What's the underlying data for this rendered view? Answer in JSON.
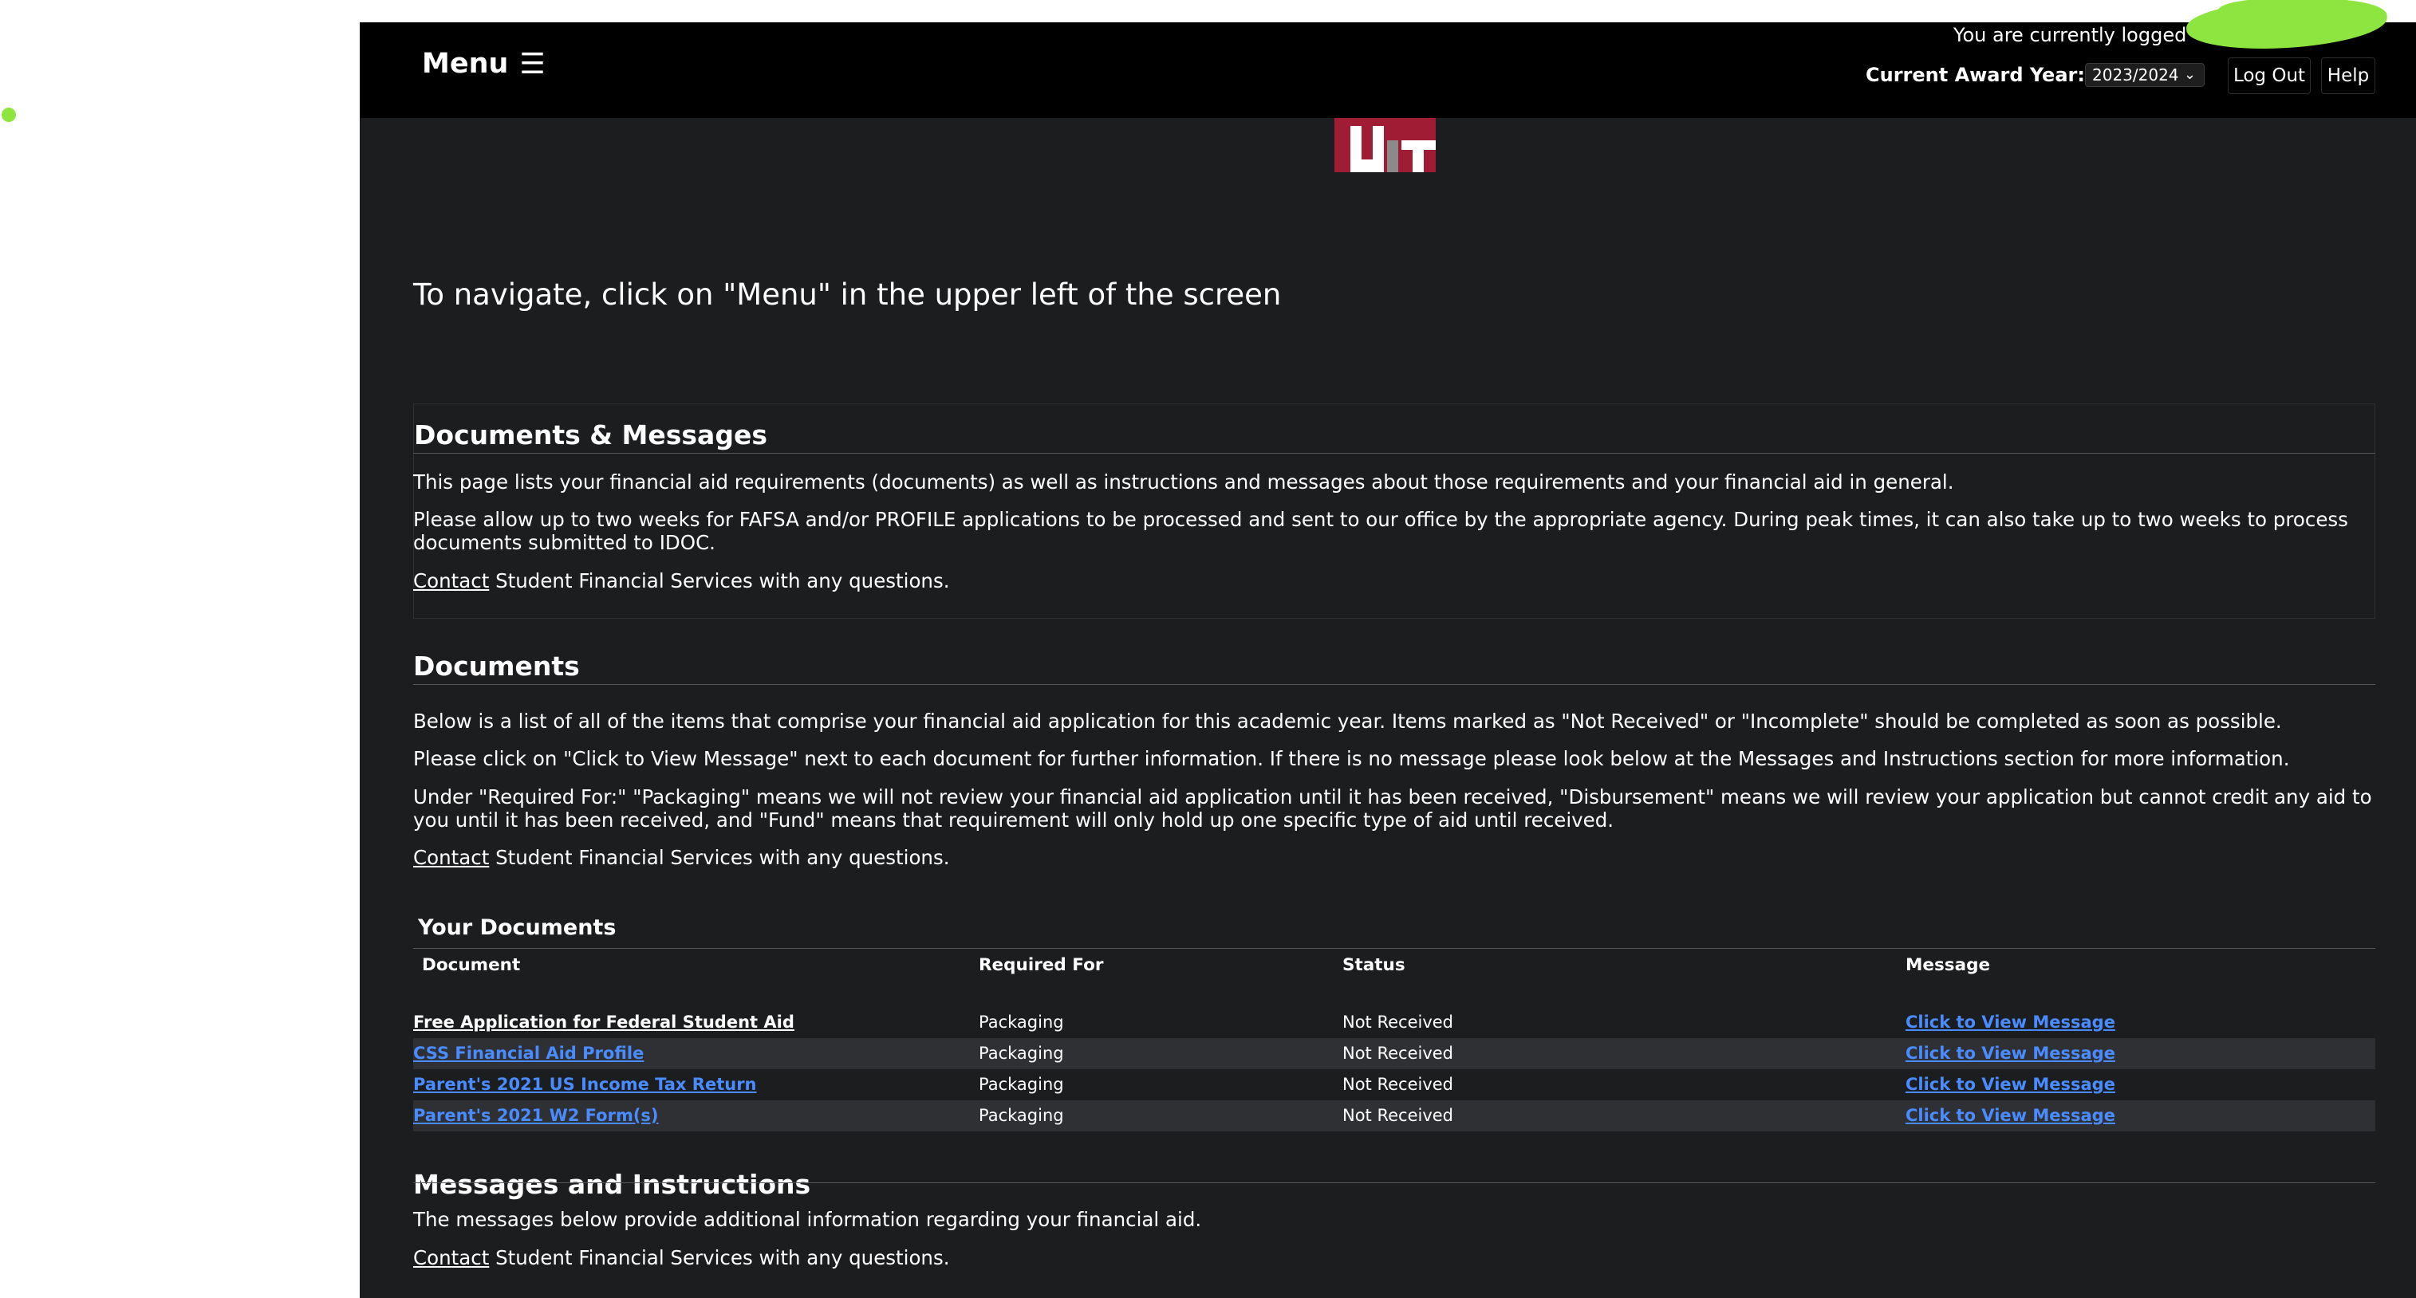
{
  "header": {
    "menu_label": "Menu",
    "menu_icon": "☰",
    "logged_in_text": "You are currently logged",
    "award_year_label": "Current Award Year:",
    "award_year_value": "2023/2024",
    "logout_label": "Log Out",
    "help_label": "Help"
  },
  "nav_hint": "To navigate, click on \"Menu\" in the upper left of the screen",
  "doc_messages": {
    "title": "Documents & Messages",
    "p1": "This page lists your financial aid requirements (documents) as well as instructions and messages about those requirements and your financial aid in general.",
    "p2": "Please allow up to two weeks for FAFSA and/or PROFILE applications to be processed and sent to our office by the appropriate agency. During peak times, it can also take up to two weeks to process documents submitted to IDOC.",
    "contact_link": "Contact",
    "contact_rest": " Student Financial Services with any questions."
  },
  "documents": {
    "title": "Documents",
    "p1": "Below is a list of all of the items that comprise your financial aid application for this academic year. Items marked as \"Not Received\" or \"Incomplete\" should be completed as soon as possible.",
    "p2": "Please click on \"Click to View Message\" next to each document for further information.  If there is no message please look below at the Messages and Instructions section for more information.",
    "p3": "Under \"Required For:\" \"Packaging\" means we will not review your financial aid application until it has been received, \"Disbursement\" means we will review your application but cannot credit any aid to you until it has been received, and \"Fund\" means that requirement will only hold up one specific type of aid until received.",
    "contact_link": "Contact",
    "contact_rest": " Student Financial Services with any questions."
  },
  "your_documents": {
    "title": "Your Documents",
    "columns": [
      "Document",
      "Required For",
      "Status",
      "Message"
    ],
    "rows": [
      {
        "document": "Free Application for Federal Student Aid",
        "required_for": "Packaging",
        "status": "Not Received",
        "message": "Click to View Message"
      },
      {
        "document": "CSS Financial Aid Profile",
        "required_for": "Packaging",
        "status": "Not Received",
        "message": "Click to View Message"
      },
      {
        "document": "Parent's 2021 US Income Tax Return",
        "required_for": "Packaging",
        "status": "Not Received",
        "message": "Click to View Message"
      },
      {
        "document": "Parent's 2021 W2 Form(s)",
        "required_for": "Packaging",
        "status": "Not Received",
        "message": "Click to View Message"
      }
    ]
  },
  "messages": {
    "title": "Messages and Instructions",
    "p1": "The messages below provide additional information regarding your financial aid.",
    "contact_link": "Contact",
    "contact_rest": " Student Financial Services with any questions."
  },
  "colors": {
    "background": "#1c1d1f",
    "topbar": "#000000",
    "link_blue": "#4a8cff",
    "alt_row": "#2f3034",
    "annotation_green": "#8ee53f",
    "logo_red": "#a01c34"
  }
}
